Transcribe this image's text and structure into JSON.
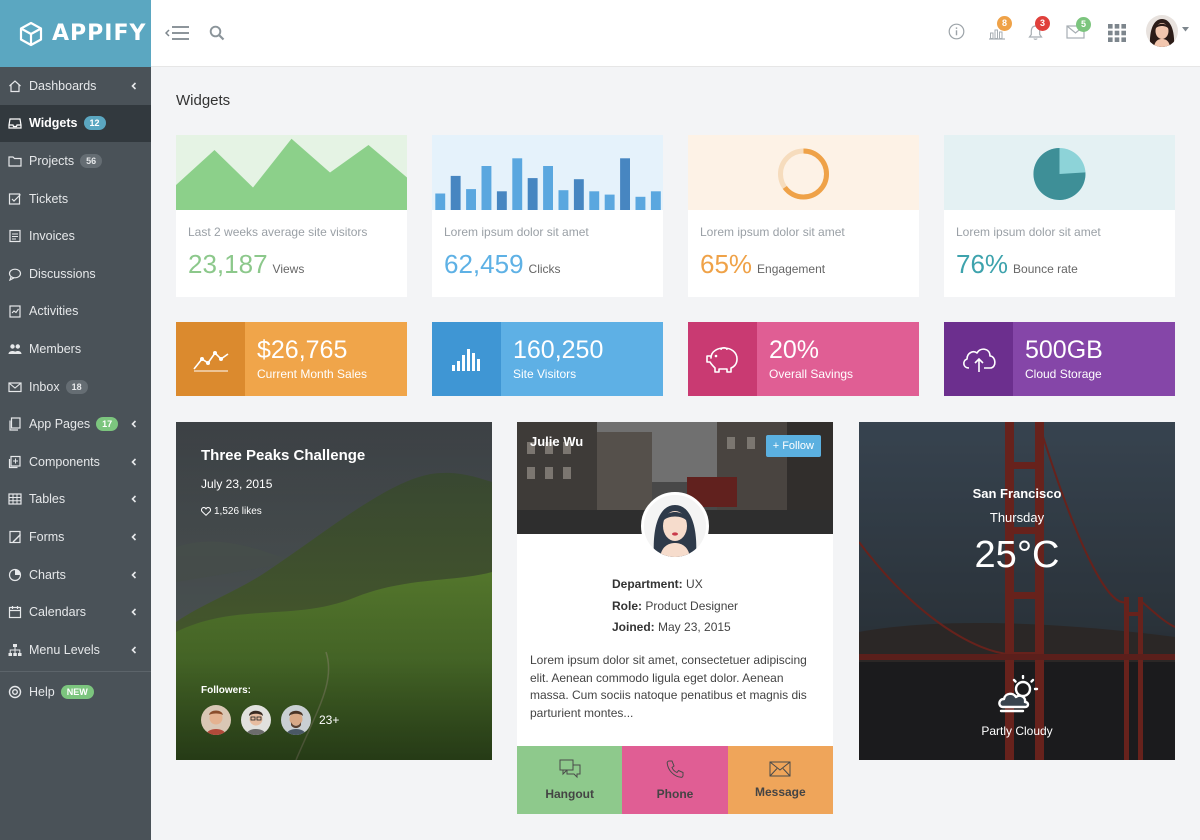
{
  "app": {
    "brand": "APPIFY",
    "accent": "#5ba7c1"
  },
  "sidebar": {
    "items": [
      {
        "label": "Dashboards",
        "icon": "home-icon",
        "arrow": true
      },
      {
        "label": "Widgets",
        "icon": "inbox-icon",
        "badge": "12",
        "active": true
      },
      {
        "label": "Projects",
        "icon": "folder-icon",
        "badge": "56"
      },
      {
        "label": "Tickets",
        "icon": "checkbox-icon"
      },
      {
        "label": "Invoices",
        "icon": "document-icon"
      },
      {
        "label": "Discussions",
        "icon": "chat-icon"
      },
      {
        "label": "Activities",
        "icon": "clipboard-icon"
      },
      {
        "label": "Members",
        "icon": "users-icon"
      },
      {
        "label": "Inbox",
        "icon": "envelope-icon",
        "badge": "18"
      },
      {
        "label": "App Pages",
        "icon": "pages-icon",
        "badge": "17",
        "arrow": true
      },
      {
        "label": "Components",
        "icon": "components-icon",
        "arrow": true
      },
      {
        "label": "Tables",
        "icon": "table-icon",
        "arrow": true
      },
      {
        "label": "Forms",
        "icon": "forms-icon",
        "arrow": true
      },
      {
        "label": "Charts",
        "icon": "pie-chart-icon",
        "arrow": true
      },
      {
        "label": "Calendars",
        "icon": "calendar-icon",
        "arrow": true
      },
      {
        "label": "Menu Levels",
        "icon": "sitemap-icon",
        "arrow": true
      }
    ],
    "help": {
      "label": "Help",
      "badge": "NEW"
    }
  },
  "topbar": {
    "badges": {
      "stats": "8",
      "notifications": "3",
      "messages": "5"
    }
  },
  "page": {
    "title": "Widgets"
  },
  "stats": [
    {
      "caption": "Last 2 weeks average site visitors",
      "value": "23,187",
      "unit": "Views",
      "color": "#8cc88b"
    },
    {
      "caption": "Lorem ipsum dolor sit amet",
      "value": "62,459",
      "unit": "Clicks",
      "color": "#5eb1e5"
    },
    {
      "caption": "Lorem ipsum dolor sit amet",
      "value": "65%",
      "unit": "Engagement",
      "color": "#efa248"
    },
    {
      "caption": "Lorem ipsum dolor sit amet",
      "value": "76%",
      "unit": "Bounce rate",
      "color": "#3ea3ad"
    }
  ],
  "chart_data": [
    {
      "type": "area",
      "values": [
        20,
        48,
        18,
        57,
        30,
        52,
        26
      ]
    },
    {
      "type": "bar",
      "values": [
        30,
        62,
        38,
        80,
        34,
        94,
        58,
        80,
        36,
        56,
        34,
        28,
        94,
        24,
        34
      ]
    },
    {
      "type": "pie",
      "values": [
        65,
        35
      ],
      "labels": [
        "Engagement",
        ""
      ]
    },
    {
      "type": "pie",
      "values": [
        76,
        24
      ],
      "labels": [
        "Bounce rate",
        ""
      ]
    }
  ],
  "tiles": [
    {
      "value": "$26,765",
      "label": "Current Month Sales",
      "icon": "trend-line-icon",
      "color": "#f0a54a"
    },
    {
      "value": "160,250",
      "label": "Site Visitors",
      "icon": "bar-chart-icon",
      "color": "#5eb0e5"
    },
    {
      "value": "20%",
      "label": "Overall Savings",
      "icon": "piggy-bank-icon",
      "color": "#e05e94"
    },
    {
      "value": "500GB",
      "label": "Cloud Storage",
      "icon": "cloud-upload-icon",
      "color": "#8546a8"
    }
  ],
  "hike": {
    "title": "Three Peaks Challenge",
    "date": "July 23, 2015",
    "likes": "1,526 likes",
    "followers_label": "Followers:",
    "followers_more": "23+"
  },
  "profile": {
    "name": "Julie Wu",
    "follow": "+ Follow",
    "dept_label": "Department:",
    "dept": "UX",
    "role_label": "Role:",
    "role": "Product Designer",
    "joined_label": "Joined:",
    "joined": "May 23, 2015",
    "bio": "Lorem ipsum dolor sit amet, consectetuer adipiscing elit. Aenean commodo ligula eget dolor. Aenean massa. Cum sociis natoque penatibus et magnis dis parturient montes...",
    "actions": {
      "hangout": "Hangout",
      "phone": "Phone",
      "message": "Message"
    }
  },
  "weather": {
    "city": "San Francisco",
    "day": "Thursday",
    "temp": "25°C",
    "condition": "Partly Cloudy"
  }
}
